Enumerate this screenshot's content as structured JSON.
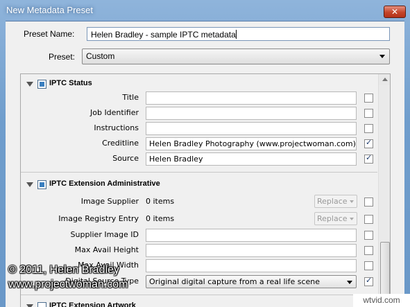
{
  "window": {
    "title": "New Metadata Preset",
    "close_glyph": "✕"
  },
  "preset_name": {
    "label": "Preset Name:",
    "value": "Helen Bradley - sample IPTC metadata"
  },
  "preset": {
    "label": "Preset:",
    "value": "Custom"
  },
  "sections": {
    "iptc_status": {
      "title": "IPTC Status",
      "enabled": true,
      "fields": [
        {
          "label": "Title",
          "value": "",
          "checked": false
        },
        {
          "label": "Job Identifier",
          "value": "",
          "checked": false
        },
        {
          "label": "Instructions",
          "value": "",
          "checked": false
        },
        {
          "label": "Creditline",
          "value": "Helen Bradley Photography (www.projectwoman.com)",
          "checked": true
        },
        {
          "label": "Source",
          "value": "Helen Bradley",
          "checked": true
        }
      ]
    },
    "iptc_ext_admin": {
      "title": "IPTC Extension Administrative",
      "enabled": true,
      "image_supplier": {
        "label": "Image Supplier",
        "count": "0 items",
        "mode": "Replace",
        "checked": false
      },
      "image_registry": {
        "label": "Image Registry Entry",
        "count": "0 items",
        "mode": "Replace",
        "checked": false
      },
      "fields": [
        {
          "label": "Supplier Image ID",
          "value": "",
          "checked": false
        },
        {
          "label": "Max Avail Height",
          "value": "",
          "checked": false
        },
        {
          "label": "Max Avail Width",
          "value": "",
          "checked": false
        }
      ],
      "digital_source": {
        "label": "Digital Source Type",
        "value": "Original digital capture from a real life scene",
        "checked": true
      }
    },
    "iptc_ext_artwork": {
      "title": "IPTC Extension Artwork",
      "enabled": false
    }
  },
  "watermark": {
    "line1": "© 2011, Helen Bradley",
    "line2": "www.projectwoman.com"
  },
  "brand": "wtvid.com"
}
